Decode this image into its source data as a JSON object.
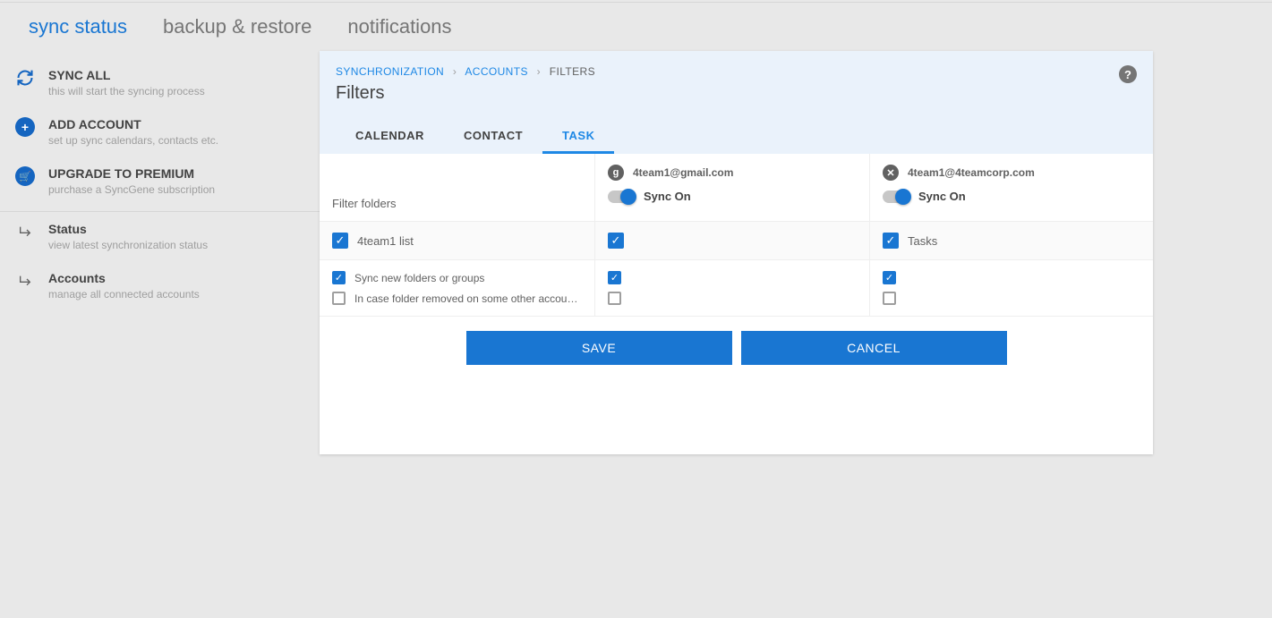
{
  "mainTabs": {
    "syncStatus": "sync status",
    "backupRestore": "backup & restore",
    "notifications": "notifications"
  },
  "sidebar": {
    "syncAll": {
      "title": "SYNC ALL",
      "subtitle": "this will start the syncing process"
    },
    "addAccount": {
      "title": "ADD ACCOUNT",
      "subtitle": "set up sync calendars, contacts etc."
    },
    "upgrade": {
      "title": "UPGRADE TO PREMIUM",
      "subtitle": "purchase a SyncGene subscription"
    },
    "status": {
      "title": "Status",
      "subtitle": "view latest synchronization status"
    },
    "accounts": {
      "title": "Accounts",
      "subtitle": "manage all connected accounts"
    }
  },
  "breadcrumb": {
    "synchronization": "SYNCHRONIZATION",
    "accounts": "ACCOUNTS",
    "filters": "FILTERS"
  },
  "panel": {
    "title": "Filters"
  },
  "subTabs": {
    "calendar": "CALENDAR",
    "contact": "CONTACT",
    "task": "TASK"
  },
  "filters": {
    "filterFoldersLabel": "Filter folders",
    "account1": {
      "email": "4team1@gmail.com",
      "syncLabel": "Sync On"
    },
    "account2": {
      "email": "4team1@4teamcorp.com",
      "syncLabel": "Sync On"
    },
    "row1": {
      "label": "4team1 list",
      "col3Label": "Tasks"
    },
    "row2": {
      "label": "Sync new folders or groups"
    },
    "row3": {
      "label": "In case folder removed on some other account - delete i..."
    }
  },
  "buttons": {
    "save": "SAVE",
    "cancel": "CANCEL"
  }
}
